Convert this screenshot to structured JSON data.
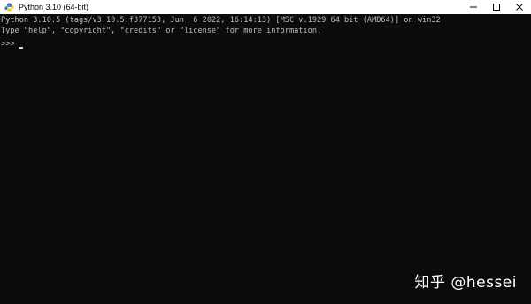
{
  "window": {
    "title": "Python 3.10 (64-bit)",
    "app_icon": "python-icon"
  },
  "console": {
    "lines": [
      "Python 3.10.5 (tags/v3.10.5:f377153, Jun  6 2022, 16:14:13) [MSC v.1929 64 bit (AMD64)] on win32",
      "Type \"help\", \"copyright\", \"credits\" or \"license\" for more information."
    ],
    "prompt": ">>>"
  },
  "watermark": {
    "text": "知乎 @hessei"
  }
}
